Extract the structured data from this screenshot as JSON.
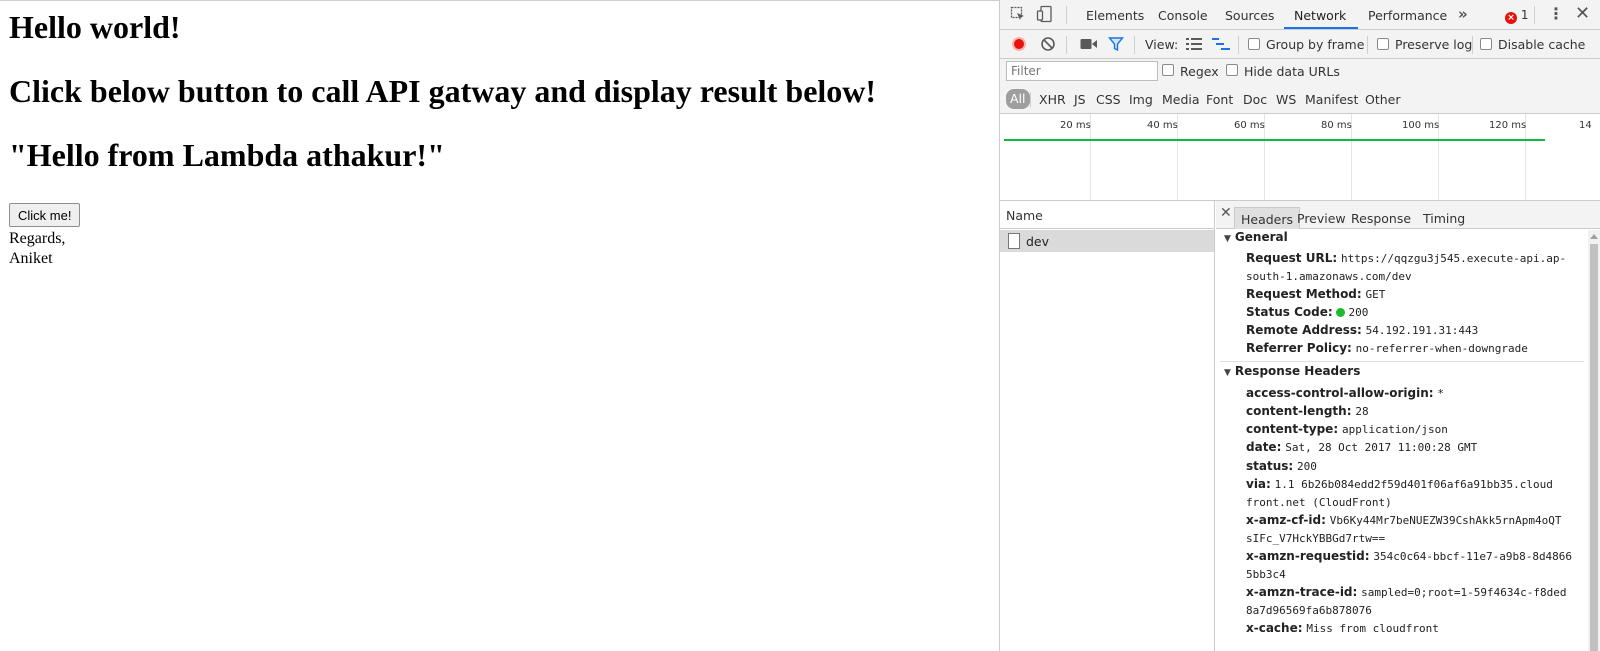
{
  "page": {
    "heading1": "Hello world!",
    "heading2": "Click below button to call API gatway and display result below!",
    "result": "\"Hello from Lambda athakur!\"",
    "button_label": "Click me!",
    "regards_line1": "Regards,",
    "regards_line2": "Aniket"
  },
  "devtools": {
    "tabs": [
      "Elements",
      "Console",
      "Sources",
      "Network",
      "Performance"
    ],
    "active_tab": "Network",
    "more_tabs": "»",
    "error_count": "1",
    "toolbar": {
      "view_label": "View:",
      "group_by_frame": "Group by frame",
      "preserve_log": "Preserve log",
      "disable_cache": "Disable cache"
    },
    "filter": {
      "placeholder": "Filter",
      "regex": "Regex",
      "hide_data_urls": "Hide data URLs"
    },
    "types": [
      "All",
      "XHR",
      "JS",
      "CSS",
      "Img",
      "Media",
      "Font",
      "Doc",
      "WS",
      "Manifest",
      "Other"
    ],
    "timeline_ticks": [
      "20 ms",
      "40 ms",
      "60 ms",
      "80 ms",
      "100 ms",
      "120 ms",
      "14"
    ],
    "name_header": "Name",
    "request_name": "dev",
    "detail_tabs": [
      "Headers",
      "Preview",
      "Response",
      "Timing"
    ],
    "general": {
      "title": "General",
      "request_url_key": "Request URL:",
      "request_url_l1": "https://qqzgu3j545.execute-api.ap-",
      "request_url_l2": "south-1.amazonaws.com/dev",
      "method_key": "Request Method:",
      "method": "GET",
      "status_key": "Status Code:",
      "status": "200",
      "remote_key": "Remote Address:",
      "remote": "54.192.191.31:443",
      "referrer_key": "Referrer Policy:",
      "referrer": "no-referrer-when-downgrade"
    },
    "response": {
      "title": "Response Headers",
      "acao_key": "access-control-allow-origin:",
      "acao": "*",
      "cl_key": "content-length:",
      "cl": "28",
      "ct_key": "content-type:",
      "ct": "application/json",
      "date_key": "date:",
      "date": "Sat, 28 Oct 2017 11:00:28 GMT",
      "status_key": "status:",
      "status": "200",
      "via_key": "via:",
      "via_l1": "1.1 6b26b084edd2f59d401f06af6a91bb35.cloud",
      "via_l2": "front.net (CloudFront)",
      "cfid_key": "x-amz-cf-id:",
      "cfid_l1": "Vb6Ky44Mr7beNUEZW39CshAkk5rnApm4oQT",
      "cfid_l2": "sIFc_V7HckYBBGd7rtw==",
      "reqid_key": "x-amzn-requestid:",
      "reqid_l1": "354c0c64-bbcf-11e7-a9b8-8d4866",
      "reqid_l2": "5bb3c4",
      "trace_key": "x-amzn-trace-id:",
      "trace_l1": "sampled=0;root=1-59f4634c-f8ded",
      "trace_l2": "8a7d96569fa6b878076",
      "cache_key": "x-cache:",
      "cache": "Miss from cloudfront"
    },
    "colors": {
      "accent": "#1a73e8",
      "record": "#e8120c",
      "status_ok": "#1bbb2e",
      "waterfall": "#14b83a"
    }
  }
}
